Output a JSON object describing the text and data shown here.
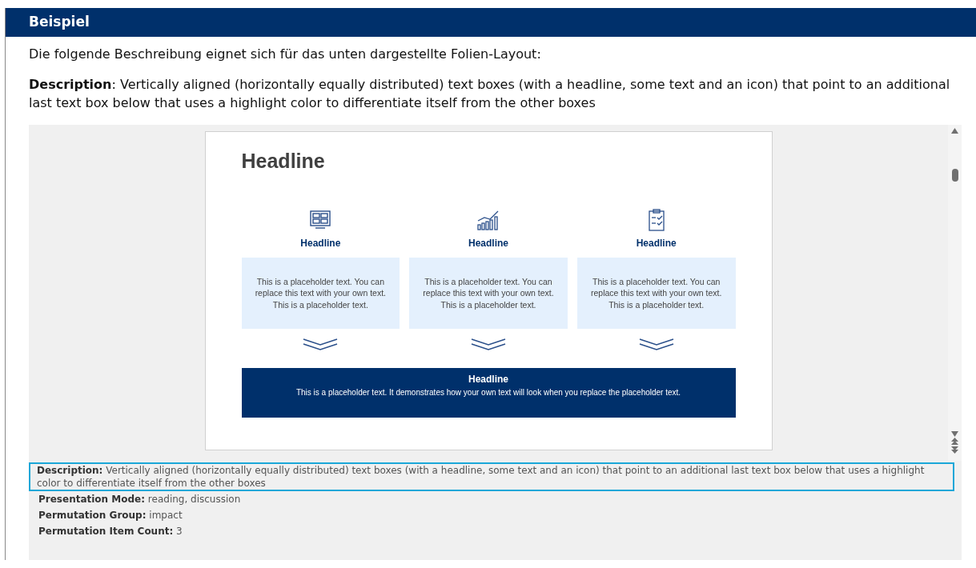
{
  "header": {
    "title": "Beispiel"
  },
  "intro": "Die folgende Beschreibung eignet sich für das unten dargestellte Folien-Layout:",
  "description": "**Description**: Vertically aligned (horizontally equally distributed) text boxes (with a headline, some text and an icon) that point to an additional last text box below that uses a highlight color to differentiate itself from the other boxes",
  "slide": {
    "headline": "Headline",
    "columns": [
      {
        "kind": "monitor",
        "headline": "Headline",
        "text": "This is a placeholder text. You can replace this text with your own text. This is a placeholder text."
      },
      {
        "kind": "chart",
        "headline": "Headline",
        "text": "This is a placeholder text. You can replace this text with your own text. This is a placeholder text."
      },
      {
        "kind": "clipboard",
        "headline": "Headline",
        "text": "This is a placeholder text. You can replace this text with your own text. This is a placeholder text."
      }
    ],
    "highlight": {
      "headline": "Headline",
      "text": "This is a placeholder text. It demonstrates how your own text will look when you replace the placeholder text."
    }
  },
  "meta": [
    {
      "text": "**Description:** Vertically aligned (horizontally equally distributed) text boxes (with a headline, some text and an icon) that point to an additional last text box below that uses a highlight color to differentiate itself from the other boxes",
      "selected": true
    },
    {
      "text": "**Presentation Mode:** reading, discussion",
      "selected": false
    },
    {
      "text": "**Permutation Group:** impact",
      "selected": false
    },
    {
      "text": "**Permutation Item Count:** 3",
      "selected": false
    }
  ]
}
